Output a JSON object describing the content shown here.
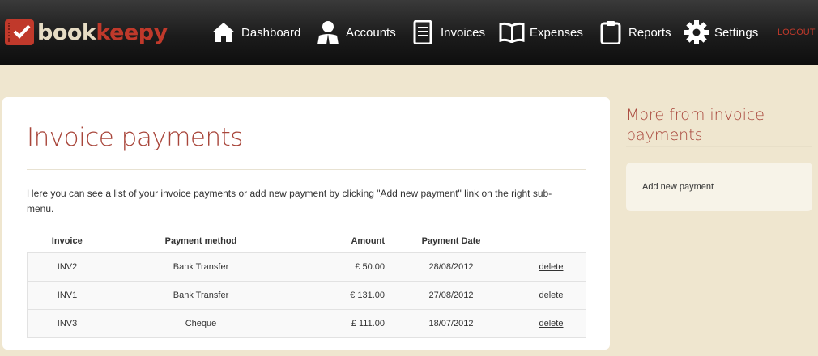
{
  "brand": {
    "part1": "book",
    "part2": "keepy"
  },
  "nav": {
    "items": [
      {
        "label": "Dashboard",
        "icon": "home-icon"
      },
      {
        "label": "Accounts",
        "icon": "user-icon"
      },
      {
        "label": "Invoices",
        "icon": "document-icon"
      },
      {
        "label": "Expenses",
        "icon": "book-icon"
      },
      {
        "label": "Reports",
        "icon": "clipboard-icon"
      },
      {
        "label": "Settings",
        "icon": "gear-icon"
      }
    ],
    "logout": "LOGOUT"
  },
  "main": {
    "title": "Invoice payments",
    "intro": "Here you can see a list of your invoice payments or add new payment by clicking \"Add new payment\" link on the right sub-menu.",
    "table": {
      "headers": [
        "Invoice",
        "Payment method",
        "Amount",
        "Payment Date"
      ],
      "rows": [
        {
          "invoice": "INV2",
          "method": "Bank Transfer",
          "amount": "£ 50.00",
          "date": "28/08/2012",
          "action": "delete"
        },
        {
          "invoice": "INV1",
          "method": "Bank Transfer",
          "amount": "€ 131.00",
          "date": "27/08/2012",
          "action": "delete"
        },
        {
          "invoice": "INV3",
          "method": "Cheque",
          "amount": "£ 111.00",
          "date": "18/07/2012",
          "action": "delete"
        }
      ]
    }
  },
  "sidebar": {
    "title": "More from invoice payments",
    "links": [
      "Add new payment"
    ]
  },
  "colors": {
    "accent": "#a8453a",
    "topbar": "#1c1c1c",
    "background": "#efe6cf"
  }
}
